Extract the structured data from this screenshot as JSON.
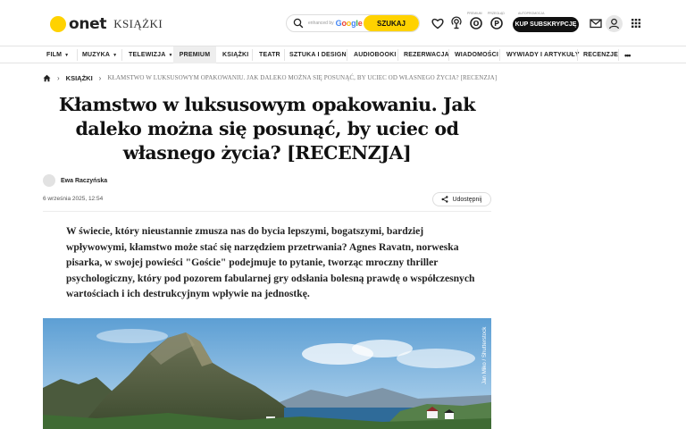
{
  "header": {
    "logo_text": "onet",
    "section": "KSIĄŻKI",
    "search_powered": "enhanced by",
    "search_google": "Google",
    "search_button": "SZUKAJ",
    "label_premium": "PREMIUM",
    "label_przegl": "PRZEGLĄD",
    "subscribe_top": "AUTOPROMOCJA",
    "subscribe_button": "KUP SUBSKRYPCJĘ"
  },
  "nav": {
    "film": "FILM",
    "muzyka": "MUZYKA",
    "telewizja": "TELEWIZJA",
    "premium": "PREMIUM",
    "ksiazki": "KSIĄŻKI",
    "teatr": "TEATR",
    "sztuka": "SZTUKA I DESIGN",
    "audiobooki": "AUDIOBOOKI",
    "rezerwacja": "REZERWACJA",
    "wiadomosci": "WIADOMOŚCI",
    "wywiady": "WYWIADY I ARTYKUŁY",
    "recenzje": "RECENZJE",
    "more": "•••"
  },
  "breadcrumb": {
    "section": "KSIĄŻKI",
    "current": "KŁAMSTWO W LUKSUSOWYM OPAKOWANIU. JAK DALEKO MOŻNA SIĘ POSUNĄĆ, BY UCIEC OD WŁASNEGO ŻYCIA? [RECENZJA]"
  },
  "article": {
    "title_line1": "Kłamstwo w luksusowym opakowaniu. Jak",
    "title_line2": "daleko można się posunąć, by uciec od",
    "title_line3": "własnego życia? [RECENZJA]",
    "author": "Ewa Raczyńska",
    "date": "6 września 2025, 12:54",
    "share": "Udostępnij",
    "lead": "W świecie, który nieustannie zmusza nas do bycia lepszymi, bogatszymi, bardziej wpływowymi, kłamstwo może stać się narzędziem przetrwania? Agnes Ravatn, norweska pisarka, w swojej powieści \"Goście\" podejmuje to pytanie, tworząc mroczny thriller psychologiczny, który pod pozorem fabularnej gry odsłania bolesną prawdę o współczesnych wartościach i ich destrukcyjnym wpływie na jednostkę.",
    "photo_credit": "Jan Miko / Shutterstock"
  },
  "icons": {
    "search": "search-icon",
    "mail": "mail-icon",
    "user": "user-icon",
    "apps": "apps-grid-icon",
    "heart": "heart-icon",
    "home": "home-icon",
    "share": "share-icon"
  },
  "colors": {
    "brand": "#ffd200",
    "dark": "#111111"
  }
}
